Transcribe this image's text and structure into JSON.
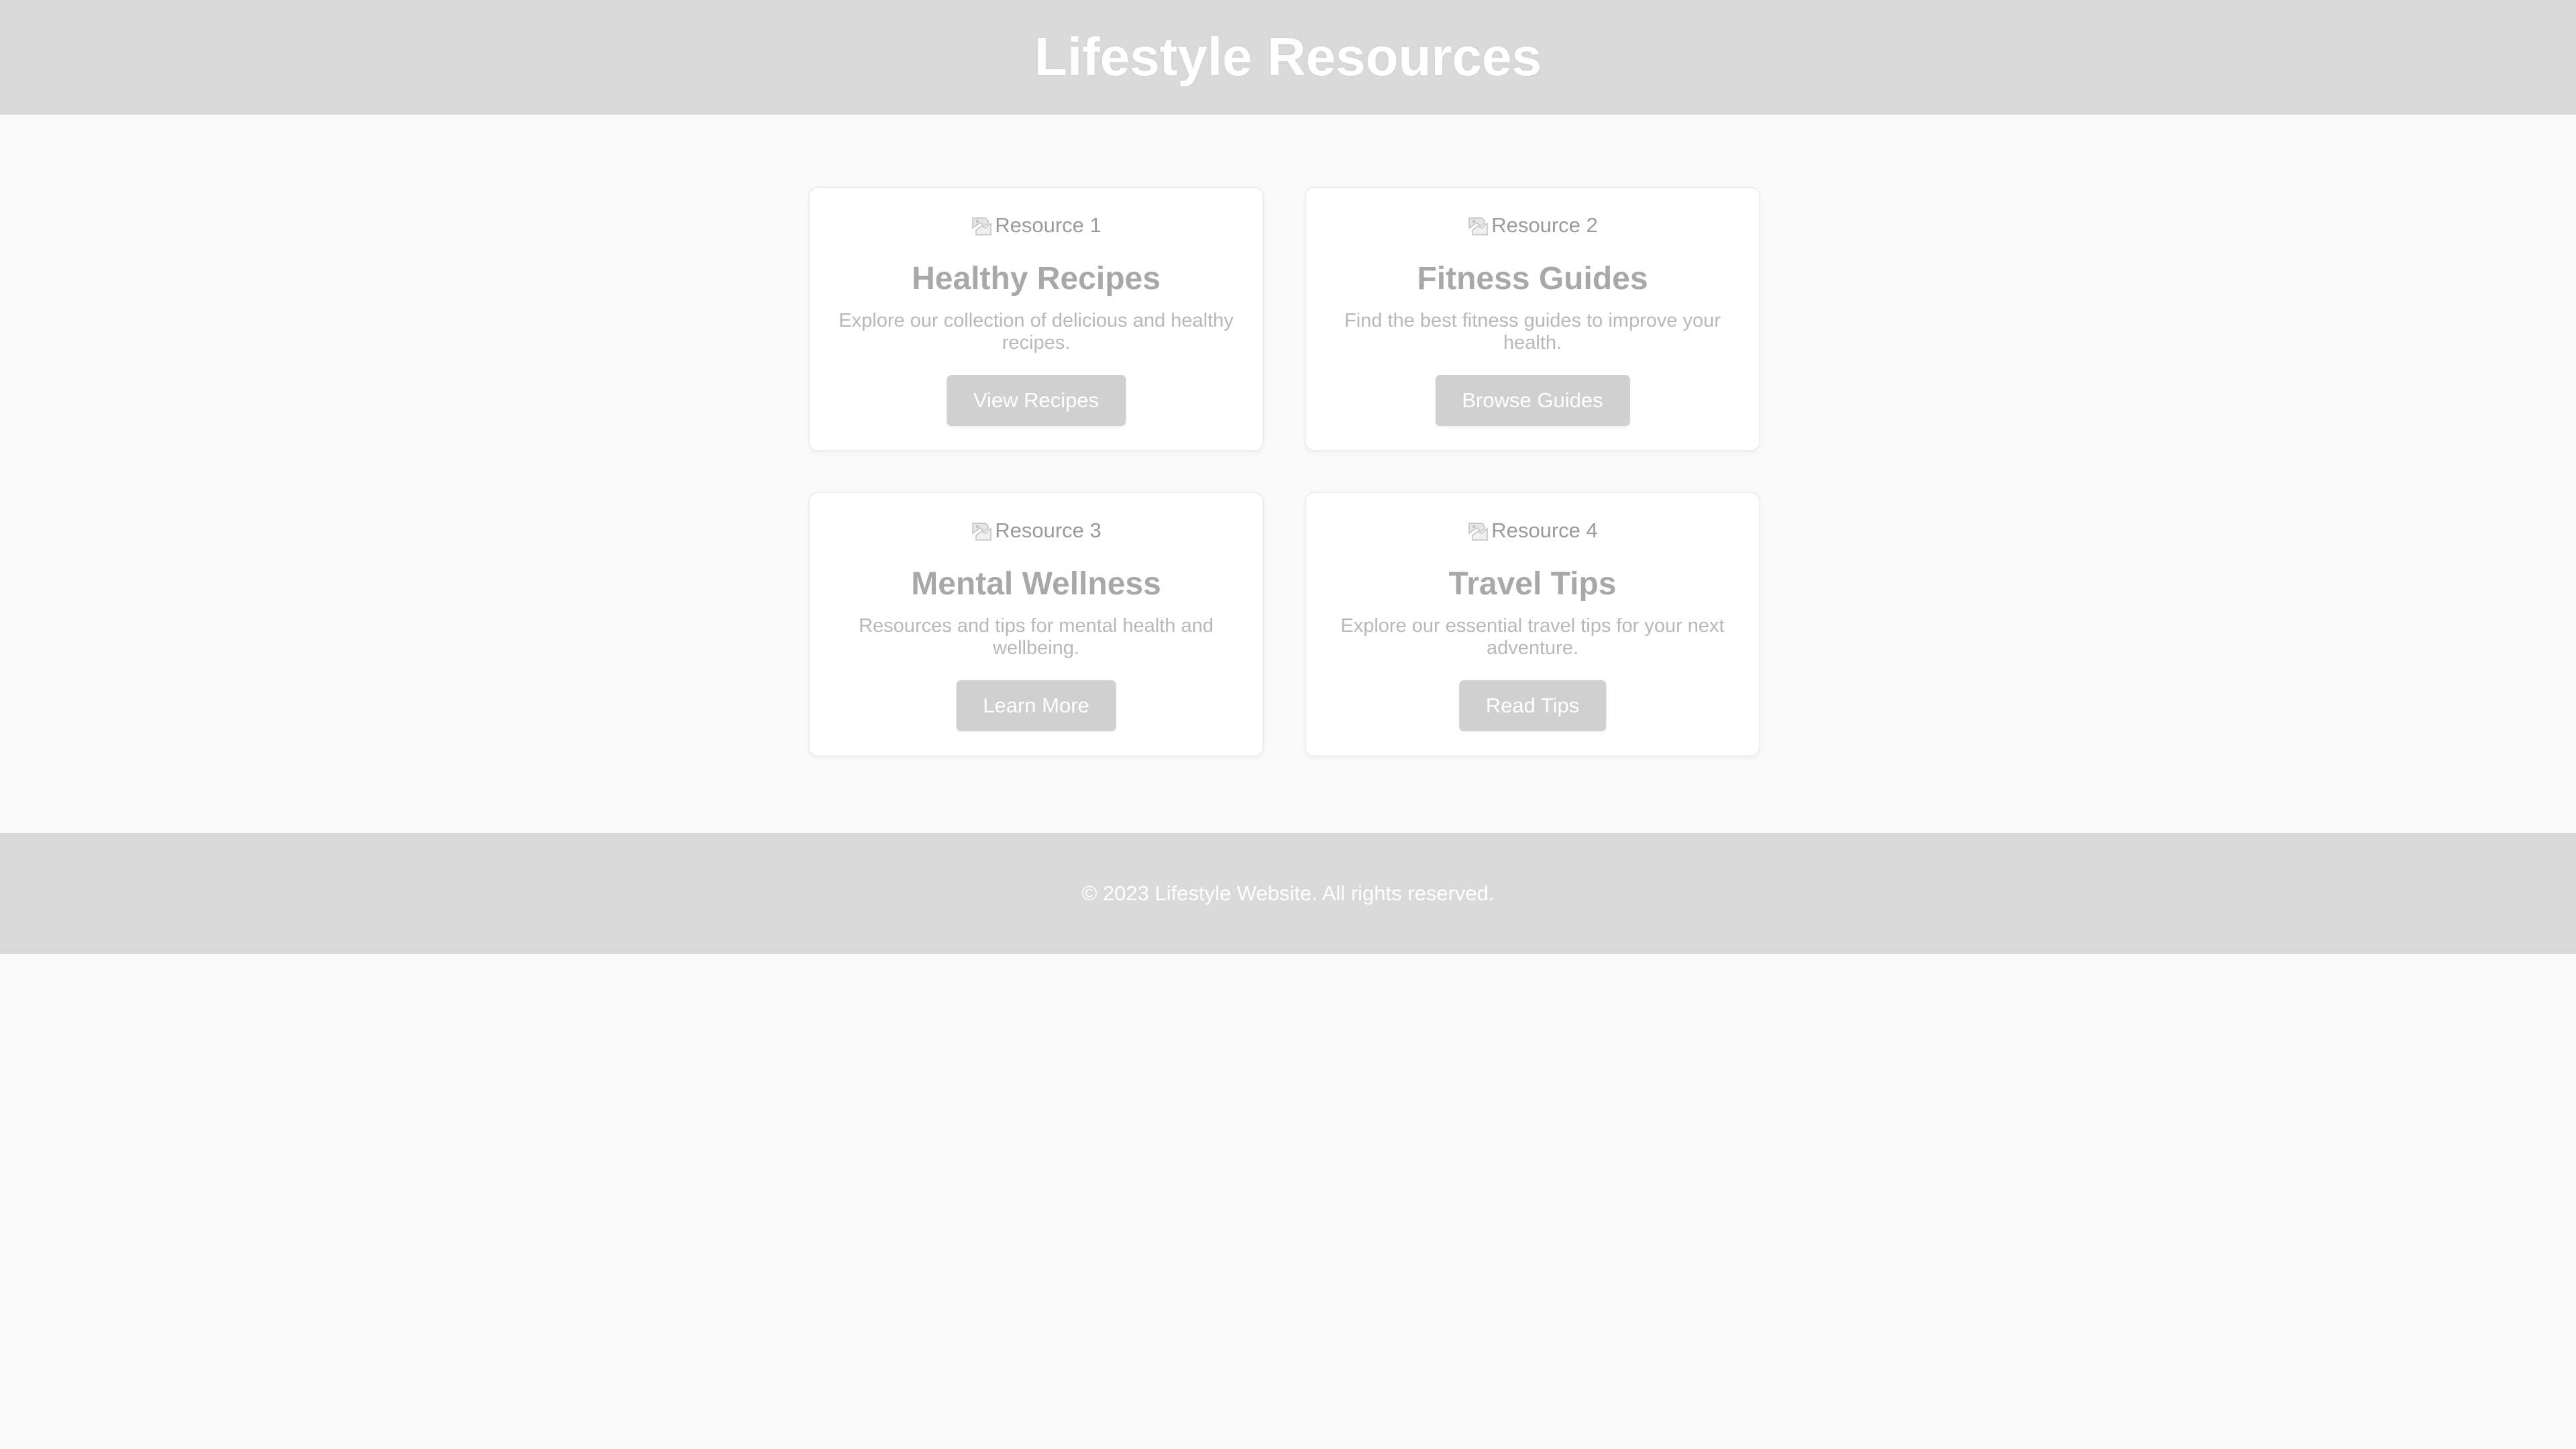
{
  "header": {
    "title": "Lifestyle Resources"
  },
  "cards": [
    {
      "image_alt": "Resource 1",
      "title": "Healthy Recipes",
      "description": "Explore our collection of delicious and healthy recipes.",
      "button_label": "View Recipes"
    },
    {
      "image_alt": "Resource 2",
      "title": "Fitness Guides",
      "description": "Find the best fitness guides to improve your health.",
      "button_label": "Browse Guides"
    },
    {
      "image_alt": "Resource 3",
      "title": "Mental Wellness",
      "description": "Resources and tips for mental health and wellbeing.",
      "button_label": "Learn More"
    },
    {
      "image_alt": "Resource 4",
      "title": "Travel Tips",
      "description": "Explore our essential travel tips for your next adventure.",
      "button_label": "Read Tips"
    }
  ],
  "footer": {
    "text": "© 2023 Lifestyle Website. All rights reserved."
  },
  "colors": {
    "header_bg": "#dadada",
    "page_bg": "#fafafa",
    "button_bg": "#d0d0d0",
    "title_text": "#a8a8a8"
  },
  "icons": {
    "card_image": "broken-image-icon"
  }
}
